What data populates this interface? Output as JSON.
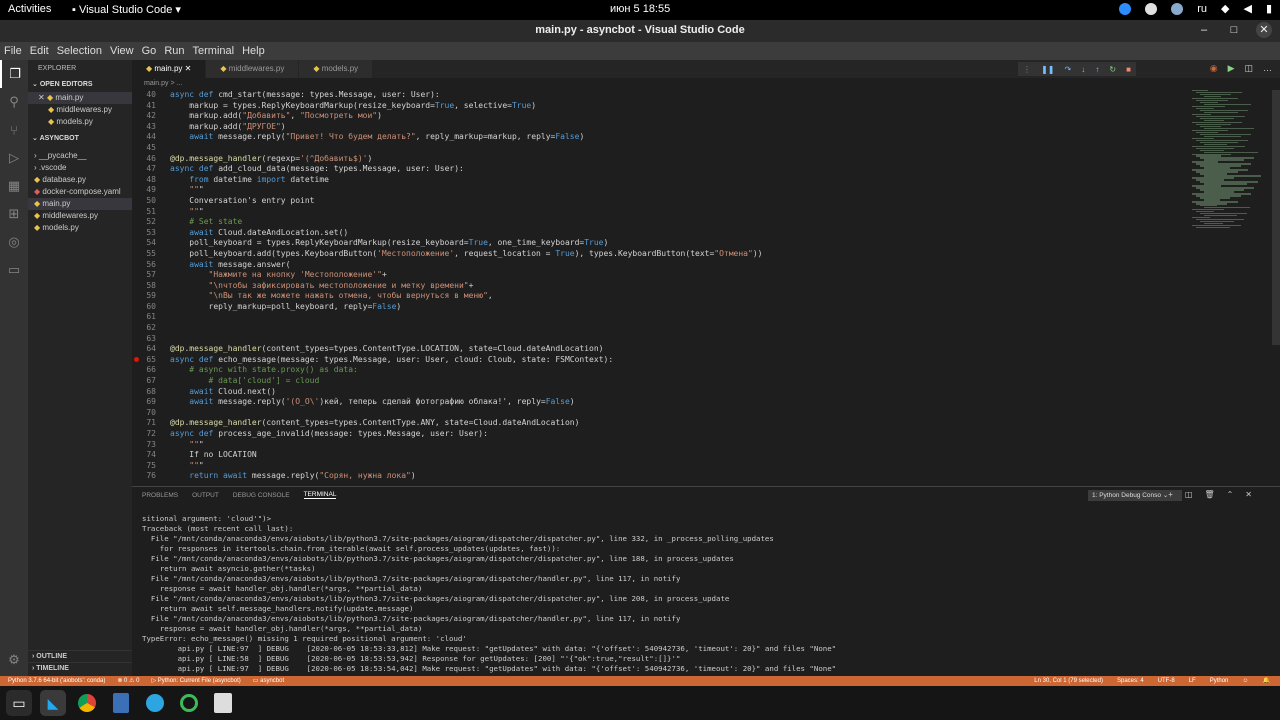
{
  "gnome": {
    "activities": "Activities",
    "app_menu": "Visual Studio Code",
    "clock": "июн 5  18:55",
    "keyboard": "ru"
  },
  "window": {
    "title": "main.py - asyncbot - Visual Studio Code"
  },
  "menu": [
    "File",
    "Edit",
    "Selection",
    "View",
    "Go",
    "Run",
    "Terminal",
    "Help"
  ],
  "sidebar": {
    "header": "EXPLORER",
    "open_editors_label": "OPEN EDITORS",
    "open_editors": [
      "main.py",
      "middlewares.py",
      "models.py"
    ],
    "folder_label": "ASYNCBOT",
    "files": [
      "__pycache__",
      ".vscode",
      "database.py",
      "docker-compose.yaml",
      "main.py",
      "middlewares.py",
      "models.py"
    ],
    "outline_label": "OUTLINE",
    "timeline_label": "TIMELINE"
  },
  "tabs": [
    "main.py",
    "middlewares.py",
    "models.py"
  ],
  "breadcrumb": "main.py > ...",
  "code": [
    {
      "n": "40",
      "t": "async def cmd_start(message: types.Message, user: User):"
    },
    {
      "n": "41",
      "t": "    markup = types.ReplyKeyboardMarkup(resize_keyboard=True, selective=True)"
    },
    {
      "n": "42",
      "t": "    markup.add(\"Добавить\", \"Посмотреть мои\")"
    },
    {
      "n": "43",
      "t": "    markup.add(\"ДРУГОЕ\")"
    },
    {
      "n": "44",
      "t": "    await message.reply(\"Привет! Что будем делать?\", reply_markup=markup, reply=False)"
    },
    {
      "n": "45",
      "t": ""
    },
    {
      "n": "46",
      "t": "@dp.message_handler(regexp='(^Добавить$)')"
    },
    {
      "n": "47",
      "t": "async def add_cloud_data(message: types.Message, user: User):"
    },
    {
      "n": "48",
      "t": "    from datetime import datetime"
    },
    {
      "n": "49",
      "t": "    \"\"\""
    },
    {
      "n": "50",
      "t": "    Conversation's entry point"
    },
    {
      "n": "51",
      "t": "    \"\"\""
    },
    {
      "n": "52",
      "t": "    # Set state"
    },
    {
      "n": "53",
      "t": "    await Cloud.dateAndLocation.set()"
    },
    {
      "n": "54",
      "t": "    poll_keyboard = types.ReplyKeyboardMarkup(resize_keyboard=True, one_time_keyboard=True)"
    },
    {
      "n": "55",
      "t": "    poll_keyboard.add(types.KeyboardButton('Местоположение', request_location = True), types.KeyboardButton(text=\"Отмена\"))"
    },
    {
      "n": "56",
      "t": "    await message.answer("
    },
    {
      "n": "57",
      "t": "        \"Нажмите на кнопку 'Местоположение'\"+"
    },
    {
      "n": "58",
      "t": "        \"\\nчтобы зафиксировать местоположение и метку времени\"+"
    },
    {
      "n": "59",
      "t": "        \"\\nВы так же можете нажать отмена, чтобы вернуться в меню\","
    },
    {
      "n": "60",
      "t": "        reply_markup=poll_keyboard, reply=False)"
    },
    {
      "n": "61",
      "t": ""
    },
    {
      "n": "62",
      "t": ""
    },
    {
      "n": "63",
      "t": ""
    },
    {
      "n": "64",
      "t": "@dp.message_handler(content_types=types.ContentType.LOCATION, state=Cloud.dateAndLocation)"
    },
    {
      "n": "65",
      "t": "async def echo_message(message: types.Message, user: User, cloud: Cloub, state: FSMContext):"
    },
    {
      "n": "66",
      "t": "    # async with state.proxy() as data:"
    },
    {
      "n": "67",
      "t": "        # data['cloud'] = cloud"
    },
    {
      "n": "68",
      "t": "    await Cloud.next()"
    },
    {
      "n": "69",
      "t": "    await message.reply('(O_O\\')кей, теперь сделай фотографию облака!', reply=False)"
    },
    {
      "n": "70",
      "t": ""
    },
    {
      "n": "71",
      "t": "@dp.message_handler(content_types=types.ContentType.ANY, state=Cloud.dateAndLocation)"
    },
    {
      "n": "72",
      "t": "async def process_age_invalid(message: types.Message, user: User):"
    },
    {
      "n": "73",
      "t": "    \"\"\""
    },
    {
      "n": "74",
      "t": "    If no LOCATION"
    },
    {
      "n": "75",
      "t": "    \"\"\""
    },
    {
      "n": "76",
      "t": "    return await message.reply(\"Сорян, нужна лока\")"
    }
  ],
  "panel": {
    "tabs": [
      "PROBLEMS",
      "OUTPUT",
      "DEBUG CONSOLE",
      "TERMINAL"
    ],
    "terminal_select": "1: Python Debug Conso"
  },
  "terminal": [
    "sitional argument: 'cloud'\")>",
    "Traceback (most recent call last):",
    "  File \"/mnt/conda/anaconda3/envs/aiobots/lib/python3.7/site-packages/aiogram/dispatcher/dispatcher.py\", line 332, in _process_polling_updates",
    "    for responses in itertools.chain.from_iterable(await self.process_updates(updates, fast)):",
    "  File \"/mnt/conda/anaconda3/envs/aiobots/lib/python3.7/site-packages/aiogram/dispatcher/dispatcher.py\", line 188, in process_updates",
    "    return await asyncio.gather(*tasks)",
    "  File \"/mnt/conda/anaconda3/envs/aiobots/lib/python3.7/site-packages/aiogram/dispatcher/handler.py\", line 117, in notify",
    "    response = await handler_obj.handler(*args, **partial_data)",
    "  File \"/mnt/conda/anaconda3/envs/aiobots/lib/python3.7/site-packages/aiogram/dispatcher/dispatcher.py\", line 208, in process_update",
    "    return await self.message_handlers.notify(update.message)",
    "  File \"/mnt/conda/anaconda3/envs/aiobots/lib/python3.7/site-packages/aiogram/dispatcher/handler.py\", line 117, in notify",
    "    response = await handler_obj.handler(*args, **partial_data)",
    "TypeError: echo_message() missing 1 required positional argument: 'cloud'",
    "        api.py [ LINE:97  ] DEBUG    [2020-06-05 18:53:33,812] Make request: \"getUpdates\" with data: \"{'offset': 540942736, 'timeout': 20}\" and files \"None\"",
    "        api.py [ LINE:58  ] DEBUG    [2020-06-05 18:53:53,942] Response for getUpdates: [200] \"'{\"ok\":true,\"result\":[]}'\"",
    "        api.py [ LINE:97  ] DEBUG    [2020-06-05 18:53:54,042] Make request: \"getUpdates\" with data: \"{'offset': 540942736, 'timeout': 20}\" and files \"None\""
  ],
  "status": {
    "interpreter": "Python 3.7.6 64-bit ('aiobots': conda)",
    "debug_config": "Python: Current File (asyncbot)",
    "folder": "asyncbot",
    "cursor": "Ln 30, Col 1 (79 selected)",
    "spaces": "Spaces: 4",
    "encoding": "UTF-8",
    "eol": "LF",
    "language": "Python"
  },
  "colors": {
    "status_bar": "#cc6633",
    "activity_bar": "#333333",
    "sidebar": "#252526",
    "editor": "#1e1e1e",
    "breakpoint": "#e51400"
  },
  "icons": [
    "explorer-icon",
    "search-icon",
    "source-control-icon",
    "run-debug-icon",
    "docker-icon",
    "extensions-icon",
    "remote-icon",
    "settings-gear-icon"
  ]
}
